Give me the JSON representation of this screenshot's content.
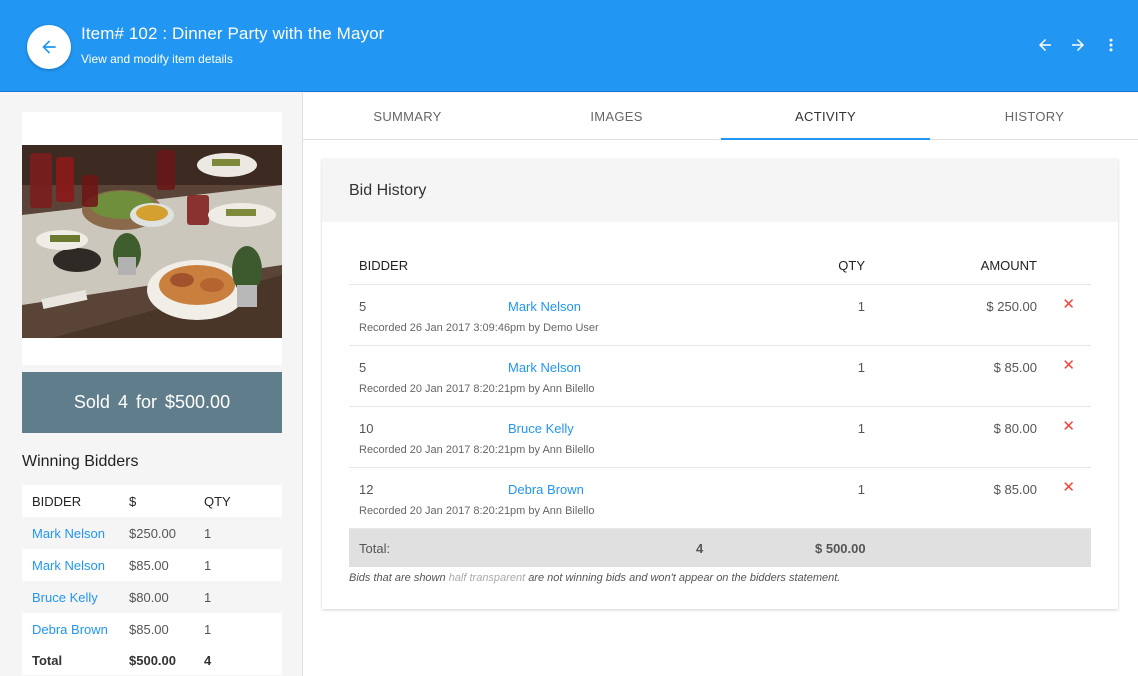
{
  "header": {
    "title": "Item# 102 : Dinner Party with the Mayor",
    "subtitle": "View and modify item details",
    "color": "#2196f3"
  },
  "sold": {
    "label": "Sold",
    "count": "4",
    "for_label": "for",
    "amount": "$500.00"
  },
  "winning": {
    "title": "Winning Bidders",
    "headers": [
      "BIDDER",
      "$",
      "QTY"
    ],
    "rows": [
      {
        "bidder": "Mark Nelson",
        "amount": "$250.00",
        "qty": "1"
      },
      {
        "bidder": "Mark Nelson",
        "amount": "$85.00",
        "qty": "1"
      },
      {
        "bidder": "Bruce Kelly",
        "amount": "$80.00",
        "qty": "1"
      },
      {
        "bidder": "Debra Brown",
        "amount": "$85.00",
        "qty": "1"
      }
    ],
    "total": {
      "label": "Total",
      "amount": "$500.00",
      "qty": "4"
    }
  },
  "tabs": [
    "SUMMARY",
    "IMAGES",
    "ACTIVITY",
    "HISTORY"
  ],
  "active_tab": "ACTIVITY",
  "bid_history": {
    "title": "Bid History",
    "headers": {
      "bidder": "BIDDER",
      "qty": "QTY",
      "amount": "AMOUNT"
    },
    "rows": [
      {
        "paddle": "5",
        "name": "Mark Nelson",
        "qty": "1",
        "amount": "$ 250.00",
        "recorded": "Recorded 26 Jan 2017 3:09:46pm by Demo User"
      },
      {
        "paddle": "5",
        "name": "Mark Nelson",
        "qty": "1",
        "amount": "$ 85.00",
        "recorded": "Recorded 20 Jan 2017 8:20:21pm by Ann Bilello"
      },
      {
        "paddle": "10",
        "name": "Bruce Kelly",
        "qty": "1",
        "amount": "$ 80.00",
        "recorded": "Recorded 20 Jan 2017 8:20:21pm by Ann Bilello"
      },
      {
        "paddle": "12",
        "name": "Debra Brown",
        "qty": "1",
        "amount": "$ 85.00",
        "recorded": "Recorded 20 Jan 2017 8:20:21pm by Ann Bilello"
      }
    ],
    "total": {
      "label": "Total:",
      "qty": "4",
      "amount": "$ 500.00"
    },
    "note_prefix": "Bids that are shown",
    "note_faint": "half transparent",
    "note_suffix": "are not winning bids and won't appear on the bidders statement."
  },
  "icons": {
    "back": "arrow-left-icon",
    "prev": "arrow-left-icon",
    "next": "arrow-right-icon",
    "menu": "more-vertical-icon",
    "delete": "close-icon"
  }
}
